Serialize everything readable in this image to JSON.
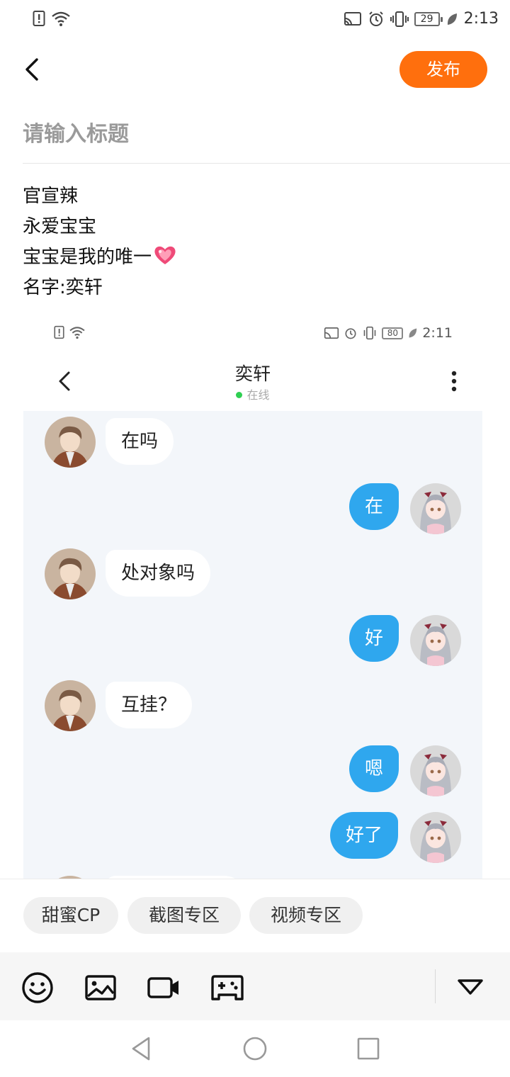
{
  "status_bar": {
    "time": "2:13",
    "battery": "29"
  },
  "top_bar": {
    "publish_label": "发布"
  },
  "post": {
    "title_placeholder": "请输入标题",
    "lines": [
      "官宣辣",
      "永爱宝宝",
      "宝宝是我的唯一",
      "名字:奕轩"
    ]
  },
  "screenshot": {
    "status_time": "2:11",
    "status_battery": "80",
    "contact_name": "奕轩",
    "contact_status": "在线",
    "messages": [
      {
        "side": "left",
        "text": "在吗"
      },
      {
        "side": "right",
        "text": "在"
      },
      {
        "side": "left",
        "text": "处对象吗"
      },
      {
        "side": "right",
        "text": "好"
      },
      {
        "side": "left",
        "text": "互挂？"
      },
      {
        "side": "right",
        "text": "嗯"
      },
      {
        "side": "right",
        "text": "好了"
      }
    ]
  },
  "topic_chips": [
    "甜蜜CP",
    "截图专区",
    "视频专区"
  ],
  "colors": {
    "accent": "#ff6f0d",
    "bubble_out": "#2fa7ee",
    "online": "#2fcf52"
  },
  "toolbar_icons": [
    "emoji-icon",
    "image-icon",
    "video-icon",
    "game-icon",
    "collapse-icon"
  ]
}
